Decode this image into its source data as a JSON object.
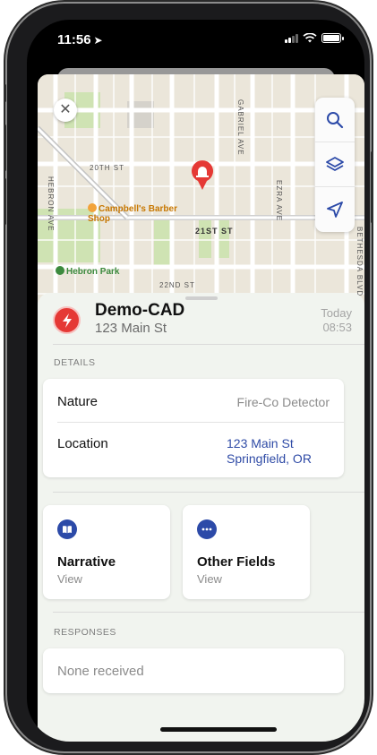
{
  "status_bar": {
    "time": "11:56"
  },
  "map": {
    "streets": [
      "20TH ST",
      "21ST ST",
      "22ND ST",
      "GABRIEL AVE",
      "EZRA AVE",
      "HEBRON AVE",
      "BETHESDA BLVD"
    ],
    "pois": {
      "barber": "Campbell's Barber Shop",
      "park": "Hebron Park"
    },
    "icons": [
      "close-icon",
      "search-icon",
      "layers-icon",
      "location-arrow-icon",
      "alarm-pin-icon"
    ]
  },
  "incident": {
    "title": "Demo-CAD",
    "address": "123 Main St",
    "date_label": "Today",
    "time_label": "08:53",
    "icon": "lightning-icon",
    "accent_color": "#e53935"
  },
  "details": {
    "section_label": "DETAILS",
    "nature_label": "Nature",
    "nature_value": "Fire-Co Detector",
    "location_label": "Location",
    "location_line1": "123 Main St",
    "location_line2": "Springfield, OR",
    "link_color": "#2f4ba6"
  },
  "tiles": [
    {
      "title": "Narrative",
      "subtitle": "View",
      "icon": "book-icon"
    },
    {
      "title": "Other Fields",
      "subtitle": "View",
      "icon": "ellipsis-icon"
    }
  ],
  "responses": {
    "section_label": "RESPONSES",
    "empty_text": "None received"
  }
}
